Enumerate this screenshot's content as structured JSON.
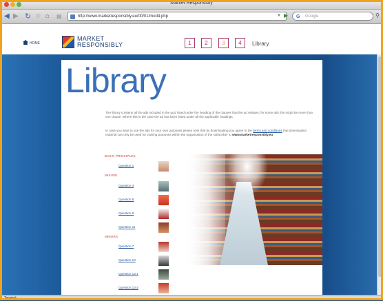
{
  "window": {
    "title": "Market Responsibly"
  },
  "toolbar": {
    "url": "http://www.marketresponsibly.eu/00/01/mod4.php",
    "search_placeholder": "Google"
  },
  "header": {
    "home_label": "HOME",
    "logo_line1": "MARKET",
    "logo_line2": "RESPONSIBLY",
    "pages": [
      "1",
      "2",
      "3",
      "4"
    ],
    "active_page": "3",
    "section_label": "Library"
  },
  "content": {
    "title": "Library",
    "para1": "The library contains all the ads included in the quiz listed under the heading of the clauses that the ad violates; for some ads this might be more than one clause. Where this is the case the ad has been listed under all the applicable headings.",
    "para2_a": "In case you want to use the ads for your own purposes please note that by downloading you agree to the ",
    "para2_link": "terms and conditions",
    "para2_b": " that downloaded material can only be used for training purposes within the organisation of the subscriber to ",
    "para2_site": "www.marketresponsibly.eu",
    "para2_end": ".",
    "sections": [
      {
        "heading": "BASIC PRINCIPLES",
        "items": [
          "Question 1"
        ]
      },
      {
        "heading": "MISUSE",
        "items": [
          "Question 4",
          "Question 8",
          "Question 9",
          "Question 11"
        ]
      },
      {
        "heading": "MINORS",
        "items": [
          "Question 7",
          "Question 10",
          "Question 13-1",
          "Question 13-2"
        ]
      }
    ]
  },
  "status": {
    "text": "Terminé"
  },
  "colors": {
    "accent": "#3a70b7",
    "link": "#2a5ba0",
    "section": "#c0392b",
    "border": "#f0a21c"
  }
}
